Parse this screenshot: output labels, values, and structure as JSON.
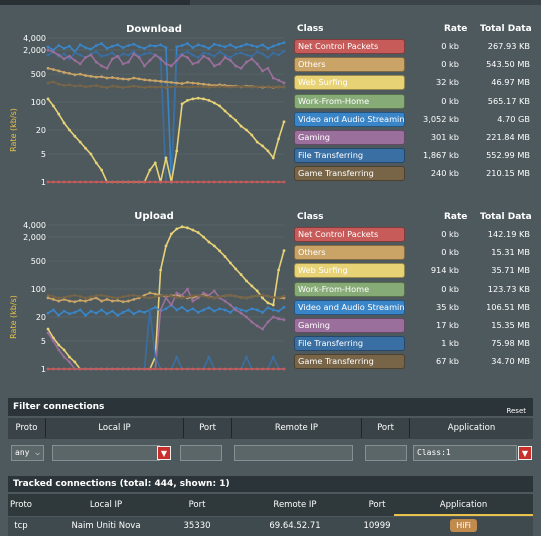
{
  "palette": {
    "net_control": "#c75b59",
    "others": "#c9a466",
    "web_surfing": "#e8d276",
    "work_from_home": "#87ab77",
    "video_audio": "#3a85c7",
    "gaming": "#9b6f9b",
    "file_transferring": "#3a6fa3",
    "game_transferring": "#786548"
  },
  "download": {
    "title": "Download",
    "ylabel": "Rate (kb/s)",
    "ticks": [
      "4,000",
      "2,000",
      "500",
      "100",
      "20",
      "5",
      "1"
    ],
    "header": {
      "class": "Class",
      "rate": "Rate",
      "total": "Total Data"
    },
    "rows": [
      {
        "class": "Net Control Packets",
        "rate": "0 kb",
        "total": "267.93 KB",
        "color": "#c75b59"
      },
      {
        "class": "Others",
        "rate": "0 kb",
        "total": "543.50 MB",
        "color": "#c9a466"
      },
      {
        "class": "Web Surfing",
        "rate": "32 kb",
        "total": "46.97 MB",
        "color": "#e8d276"
      },
      {
        "class": "Work-From-Home",
        "rate": "0 kb",
        "total": "565.17 KB",
        "color": "#87ab77"
      },
      {
        "class": "Video and Audio Streaming",
        "rate": "3,052 kb",
        "total": "4.70 GB",
        "color": "#3a85c7"
      },
      {
        "class": "Gaming",
        "rate": "301 kb",
        "total": "221.84 MB",
        "color": "#9b6f9b"
      },
      {
        "class": "File Transferring",
        "rate": "1,867 kb",
        "total": "552.99 MB",
        "color": "#3a6fa3"
      },
      {
        "class": "Game Transferring",
        "rate": "240 kb",
        "total": "210.15 MB",
        "color": "#786548"
      }
    ]
  },
  "upload": {
    "title": "Upload",
    "ylabel": "Rate (kb/s)",
    "ticks": [
      "4,000",
      "2,000",
      "500",
      "100",
      "20",
      "5",
      "1"
    ],
    "header": {
      "class": "Class",
      "rate": "Rate",
      "total": "Total Data"
    },
    "rows": [
      {
        "class": "Net Control Packets",
        "rate": "0 kb",
        "total": "142.19 KB",
        "color": "#c75b59"
      },
      {
        "class": "Others",
        "rate": "0 kb",
        "total": "15.31 MB",
        "color": "#c9a466"
      },
      {
        "class": "Web Surfing",
        "rate": "914 kb",
        "total": "35.71 MB",
        "color": "#e8d276"
      },
      {
        "class": "Work-From-Home",
        "rate": "0 kb",
        "total": "123.73 KB",
        "color": "#87ab77"
      },
      {
        "class": "Video and Audio Streaming",
        "rate": "35 kb",
        "total": "106.51 MB",
        "color": "#3a85c7"
      },
      {
        "class": "Gaming",
        "rate": "17 kb",
        "total": "15.35 MB",
        "color": "#9b6f9b"
      },
      {
        "class": "File Transferring",
        "rate": "1 kb",
        "total": "75.98 MB",
        "color": "#3a6fa3"
      },
      {
        "class": "Game Transferring",
        "rate": "67 kb",
        "total": "34.70 MB",
        "color": "#786548"
      }
    ]
  },
  "chart_data": [
    {
      "type": "line",
      "title": "Download",
      "ylabel": "Rate (kb/s)",
      "yscale": "log",
      "ylim": [
        1,
        4000
      ],
      "yticks": [
        4000,
        2000,
        500,
        100,
        20,
        5,
        1
      ],
      "series": [
        {
          "name": "Video and Audio Streaming",
          "color": "#3a85c7",
          "values": [
            2400,
            2000,
            2600,
            2200,
            2500,
            1800,
            2700,
            2300,
            2100,
            2600,
            2900,
            2200,
            2500,
            2700,
            2300,
            2600,
            2800,
            2400,
            2200,
            2600,
            2500,
            2700,
            2300,
            1,
            2400,
            2600,
            2900,
            2300,
            2700,
            2500,
            2200,
            2800,
            2600,
            2400,
            2700,
            2300,
            2500,
            2800,
            2600,
            2400,
            2700,
            2200,
            2500,
            2800,
            3052
          ]
        },
        {
          "name": "File Transferring",
          "color": "#3a6fa3",
          "values": [
            1500,
            1800,
            1400,
            1600,
            1200,
            1700,
            1500,
            1300,
            1600,
            1800,
            1400,
            1500,
            1700,
            1300,
            1600,
            1500,
            1800,
            1400,
            1600,
            1700,
            1500,
            1300,
            1,
            1,
            1400,
            1600,
            1800,
            1500,
            1300,
            1700,
            1600,
            1400,
            1800,
            1500,
            1300,
            1600,
            1700,
            1500,
            1400,
            1800,
            1600,
            1300,
            1700,
            1500,
            1867
          ]
        },
        {
          "name": "Gaming",
          "color": "#9b6f9b",
          "values": [
            2000,
            1800,
            1500,
            1200,
            1400,
            1100,
            900,
            1300,
            1500,
            1000,
            800,
            700,
            1200,
            1400,
            900,
            1000,
            1600,
            1300,
            800,
            1100,
            1500,
            1200,
            900,
            800,
            1100,
            1500,
            1300,
            900,
            1000,
            1400,
            1200,
            800,
            900,
            1300,
            1100,
            800,
            700,
            1000,
            1200,
            900,
            600,
            700,
            400,
            350,
            301
          ]
        },
        {
          "name": "Others",
          "color": "#c9a466",
          "values": [
            700,
            650,
            600,
            550,
            520,
            480,
            500,
            460,
            440,
            420,
            430,
            400,
            410,
            390,
            380,
            370,
            400,
            380,
            360,
            350,
            340,
            330,
            320,
            310,
            300,
            290,
            310,
            300,
            290,
            280,
            270,
            260,
            270,
            260,
            250,
            250,
            240,
            250,
            245,
            240,
            235,
            240,
            230,
            240,
            240
          ]
        },
        {
          "name": "Game Transferring",
          "color": "#786548",
          "values": [
            300,
            320,
            280,
            260,
            270,
            250,
            260,
            240,
            250,
            260,
            240,
            230,
            250,
            240,
            230,
            240,
            250,
            240,
            230,
            240,
            235,
            240,
            230,
            240,
            245,
            240,
            235,
            240,
            245,
            240,
            235,
            240,
            245,
            240,
            235,
            240,
            245,
            240,
            235,
            240,
            245,
            240,
            235,
            240,
            240
          ]
        },
        {
          "name": "Web Surfing",
          "color": "#e8d276",
          "values": [
            120,
            80,
            50,
            30,
            20,
            14,
            10,
            7,
            5,
            3,
            2,
            1,
            1,
            1,
            1,
            1,
            1,
            1,
            1,
            2,
            3,
            1,
            4,
            1,
            6,
            90,
            110,
            120,
            125,
            120,
            110,
            95,
            80,
            60,
            45,
            35,
            25,
            20,
            15,
            10,
            8,
            6,
            4,
            12,
            32
          ]
        },
        {
          "name": "Net Control Packets",
          "color": "#c75b59",
          "values": [
            1,
            1,
            1,
            1,
            1,
            1,
            1,
            1,
            1,
            1,
            1,
            1,
            1,
            1,
            1,
            1,
            1,
            1,
            1,
            1,
            1,
            1,
            1,
            1,
            1,
            1,
            1,
            1,
            1,
            1,
            1,
            1,
            1,
            1,
            1,
            1,
            1,
            1,
            1,
            1,
            1,
            1,
            1,
            1,
            1
          ]
        }
      ]
    },
    {
      "type": "line",
      "title": "Upload",
      "ylabel": "Rate (kb/s)",
      "yscale": "log",
      "ylim": [
        1,
        4000
      ],
      "yticks": [
        4000,
        2000,
        500,
        100,
        20,
        5,
        1
      ],
      "series": [
        {
          "name": "Web Surfing",
          "color": "#e8d276",
          "values": [
            10,
            6,
            4,
            3,
            2,
            1.5,
            1,
            1,
            1,
            1,
            1,
            1,
            1,
            1,
            1,
            1,
            1,
            1,
            1,
            1,
            2,
            300,
            1200,
            2400,
            3200,
            3600,
            3400,
            3000,
            2600,
            2000,
            1500,
            1200,
            900,
            650,
            450,
            320,
            230,
            160,
            120,
            90,
            60,
            45,
            40,
            300,
            914
          ]
        },
        {
          "name": "Others",
          "color": "#c9a466",
          "values": [
            60,
            55,
            50,
            55,
            50,
            48,
            52,
            50,
            55,
            60,
            50,
            55,
            50,
            52,
            48,
            50,
            55,
            60,
            70,
            80,
            75,
            70,
            65,
            68,
            70,
            65,
            60,
            62,
            66,
            70,
            65,
            60,
            64,
            68,
            70,
            66,
            62,
            60,
            64,
            68,
            70,
            66,
            62,
            60,
            60
          ]
        },
        {
          "name": "Video and Audio Streaming",
          "color": "#3a85c7",
          "values": [
            25,
            30,
            22,
            28,
            24,
            26,
            30,
            22,
            28,
            25,
            30,
            24,
            28,
            22,
            26,
            30,
            24,
            28,
            26,
            30,
            35,
            28,
            32,
            40,
            30,
            35,
            28,
            32,
            26,
            30,
            34,
            28,
            32,
            30,
            26,
            34,
            30,
            28,
            32,
            30,
            26,
            34,
            30,
            28,
            35
          ]
        },
        {
          "name": "Gaming",
          "color": "#9b6f9b",
          "values": [
            8,
            5,
            3,
            2,
            1.5,
            1,
            1,
            1,
            1,
            1,
            1,
            1,
            1,
            1,
            1,
            1,
            1,
            1,
            1,
            1,
            1,
            30,
            60,
            40,
            80,
            70,
            100,
            50,
            60,
            80,
            70,
            90,
            60,
            50,
            40,
            30,
            25,
            20,
            15,
            12,
            10,
            15,
            20,
            18,
            17
          ]
        },
        {
          "name": "File Transferring",
          "color": "#3a6fa3",
          "values": [
            1,
            1,
            1,
            1,
            1,
            1,
            1,
            1,
            1,
            1,
            1,
            1,
            1,
            1,
            1,
            1,
            1,
            1,
            1,
            30,
            2,
            1,
            1,
            1,
            2,
            1,
            1,
            1,
            1,
            1,
            2,
            1,
            1,
            1,
            1,
            1,
            1,
            2,
            1,
            1,
            1,
            1,
            2,
            1,
            1
          ]
        },
        {
          "name": "Game Transferring",
          "color": "#786548",
          "values": [
            70,
            65,
            60,
            62,
            66,
            70,
            65,
            60,
            64,
            68,
            70,
            66,
            62,
            60,
            64,
            68,
            70,
            66,
            62,
            60,
            64,
            68,
            70,
            66,
            62,
            60,
            64,
            68,
            70,
            66,
            62,
            60,
            64,
            68,
            70,
            66,
            62,
            60,
            64,
            68,
            70,
            66,
            62,
            60,
            67
          ]
        },
        {
          "name": "Net Control Packets",
          "color": "#c75b59",
          "values": [
            1,
            1,
            1,
            1,
            1,
            1,
            1,
            1,
            1,
            1,
            1,
            1,
            1,
            1,
            1,
            1,
            1,
            1,
            1,
            1,
            1,
            1,
            1,
            1,
            1,
            1,
            1,
            1,
            1,
            1,
            1,
            1,
            1,
            1,
            1,
            1,
            1,
            1,
            1,
            1,
            1,
            1,
            1,
            1,
            1
          ]
        }
      ]
    }
  ],
  "filter": {
    "title": "Filter connections",
    "reset": "Reset",
    "headers": {
      "proto": "Proto",
      "local_ip": "Local IP",
      "port": "Port",
      "remote_ip": "Remote IP",
      "remote_port": "Port",
      "application": "Application"
    },
    "proto_value": "any",
    "application_value": "Class:1"
  },
  "tracked": {
    "title": "Tracked connections (total: 444, shown: 1)",
    "headers": {
      "proto": "Proto",
      "local_ip": "Local IP",
      "port": "Port",
      "remote_ip": "Remote IP",
      "remote_port": "Port",
      "application": "Application"
    },
    "rows": [
      {
        "proto": "tcp",
        "local_ip": "Naim Uniti Nova",
        "port": "35330",
        "remote_ip": "69.64.52.71",
        "remote_port": "10999",
        "application": "HiFi"
      }
    ]
  }
}
